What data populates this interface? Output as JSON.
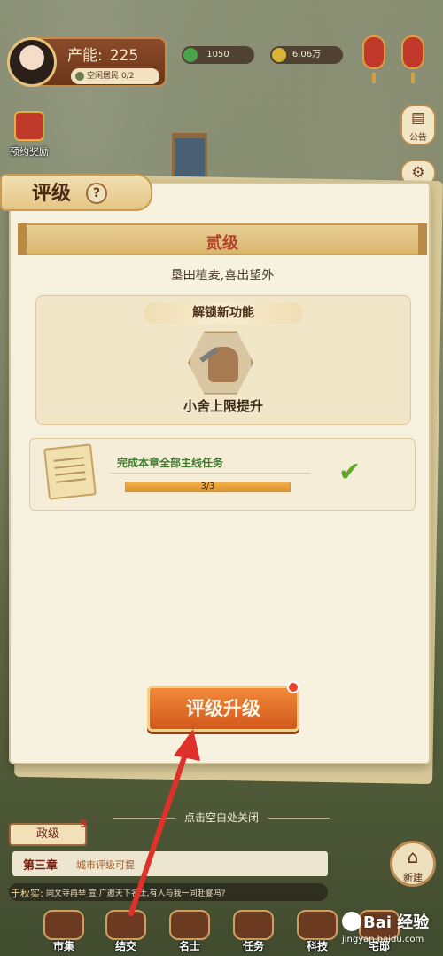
{
  "hud": {
    "capacity_label": "产能:",
    "capacity_value": "225",
    "residents": "空闲居民:0/2",
    "resource_1": "1050",
    "resource_2": "6.06万"
  },
  "side": {
    "notice_label": "公告",
    "reward_label": "预约奖励"
  },
  "panel": {
    "title": "评级",
    "help_glyph": "?",
    "level_name": "贰级",
    "level_desc": "垦田植麦,喜出望外",
    "unlock_header": "解锁新功能",
    "feature_name": "小舍上限提升",
    "task": {
      "title": "完成本章全部主线任务",
      "progress_text": "3/3",
      "progress_fraction": 1.0,
      "check_glyph": "✔"
    },
    "upgrade_button": "评级升级"
  },
  "bottom": {
    "close_hint": "点击空白处关闭",
    "chapter_tab": "政级",
    "chapter_badge": "9",
    "chapter_num": "第三章",
    "chapter_goal": "城市评级可提",
    "chat_speaker": "于秋实:",
    "chat_text": "同文寺再举 宣 广邀天下名士,有人与我一同赴宴吗?",
    "new_button": "新建",
    "nav": [
      "市集",
      "结交",
      "名士",
      "任务",
      "科技",
      "宅邸"
    ]
  },
  "watermark": {
    "brand": "Bai 经验",
    "site": "jingyan.baidu.com"
  },
  "colors": {
    "panel_bg": "#f7f1e0",
    "level_red": "#b4432c",
    "task_green": "#3e7a2c",
    "button_orange": "#d2581c",
    "arrow_red": "#e0302a"
  }
}
